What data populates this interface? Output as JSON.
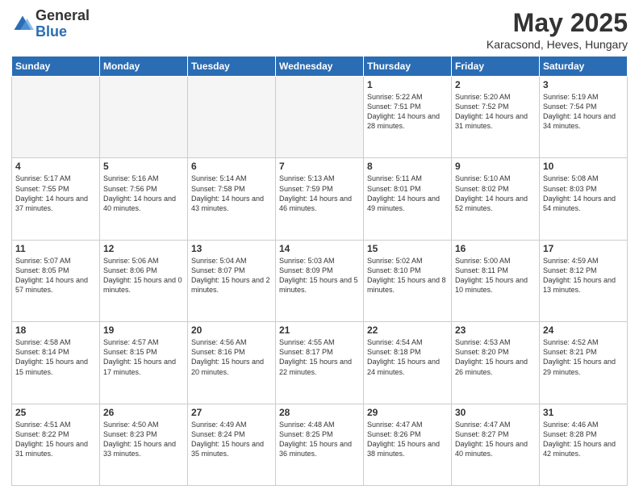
{
  "logo": {
    "general": "General",
    "blue": "Blue"
  },
  "header": {
    "month": "May 2025",
    "location": "Karacsond, Heves, Hungary"
  },
  "weekdays": [
    "Sunday",
    "Monday",
    "Tuesday",
    "Wednesday",
    "Thursday",
    "Friday",
    "Saturday"
  ],
  "weeks": [
    [
      {
        "day": "",
        "info": ""
      },
      {
        "day": "",
        "info": ""
      },
      {
        "day": "",
        "info": ""
      },
      {
        "day": "",
        "info": ""
      },
      {
        "day": "1",
        "info": "Sunrise: 5:22 AM\nSunset: 7:51 PM\nDaylight: 14 hours\nand 28 minutes."
      },
      {
        "day": "2",
        "info": "Sunrise: 5:20 AM\nSunset: 7:52 PM\nDaylight: 14 hours\nand 31 minutes."
      },
      {
        "day": "3",
        "info": "Sunrise: 5:19 AM\nSunset: 7:54 PM\nDaylight: 14 hours\nand 34 minutes."
      }
    ],
    [
      {
        "day": "4",
        "info": "Sunrise: 5:17 AM\nSunset: 7:55 PM\nDaylight: 14 hours\nand 37 minutes."
      },
      {
        "day": "5",
        "info": "Sunrise: 5:16 AM\nSunset: 7:56 PM\nDaylight: 14 hours\nand 40 minutes."
      },
      {
        "day": "6",
        "info": "Sunrise: 5:14 AM\nSunset: 7:58 PM\nDaylight: 14 hours\nand 43 minutes."
      },
      {
        "day": "7",
        "info": "Sunrise: 5:13 AM\nSunset: 7:59 PM\nDaylight: 14 hours\nand 46 minutes."
      },
      {
        "day": "8",
        "info": "Sunrise: 5:11 AM\nSunset: 8:01 PM\nDaylight: 14 hours\nand 49 minutes."
      },
      {
        "day": "9",
        "info": "Sunrise: 5:10 AM\nSunset: 8:02 PM\nDaylight: 14 hours\nand 52 minutes."
      },
      {
        "day": "10",
        "info": "Sunrise: 5:08 AM\nSunset: 8:03 PM\nDaylight: 14 hours\nand 54 minutes."
      }
    ],
    [
      {
        "day": "11",
        "info": "Sunrise: 5:07 AM\nSunset: 8:05 PM\nDaylight: 14 hours\nand 57 minutes."
      },
      {
        "day": "12",
        "info": "Sunrise: 5:06 AM\nSunset: 8:06 PM\nDaylight: 15 hours\nand 0 minutes."
      },
      {
        "day": "13",
        "info": "Sunrise: 5:04 AM\nSunset: 8:07 PM\nDaylight: 15 hours\nand 2 minutes."
      },
      {
        "day": "14",
        "info": "Sunrise: 5:03 AM\nSunset: 8:09 PM\nDaylight: 15 hours\nand 5 minutes."
      },
      {
        "day": "15",
        "info": "Sunrise: 5:02 AM\nSunset: 8:10 PM\nDaylight: 15 hours\nand 8 minutes."
      },
      {
        "day": "16",
        "info": "Sunrise: 5:00 AM\nSunset: 8:11 PM\nDaylight: 15 hours\nand 10 minutes."
      },
      {
        "day": "17",
        "info": "Sunrise: 4:59 AM\nSunset: 8:12 PM\nDaylight: 15 hours\nand 13 minutes."
      }
    ],
    [
      {
        "day": "18",
        "info": "Sunrise: 4:58 AM\nSunset: 8:14 PM\nDaylight: 15 hours\nand 15 minutes."
      },
      {
        "day": "19",
        "info": "Sunrise: 4:57 AM\nSunset: 8:15 PM\nDaylight: 15 hours\nand 17 minutes."
      },
      {
        "day": "20",
        "info": "Sunrise: 4:56 AM\nSunset: 8:16 PM\nDaylight: 15 hours\nand 20 minutes."
      },
      {
        "day": "21",
        "info": "Sunrise: 4:55 AM\nSunset: 8:17 PM\nDaylight: 15 hours\nand 22 minutes."
      },
      {
        "day": "22",
        "info": "Sunrise: 4:54 AM\nSunset: 8:18 PM\nDaylight: 15 hours\nand 24 minutes."
      },
      {
        "day": "23",
        "info": "Sunrise: 4:53 AM\nSunset: 8:20 PM\nDaylight: 15 hours\nand 26 minutes."
      },
      {
        "day": "24",
        "info": "Sunrise: 4:52 AM\nSunset: 8:21 PM\nDaylight: 15 hours\nand 29 minutes."
      }
    ],
    [
      {
        "day": "25",
        "info": "Sunrise: 4:51 AM\nSunset: 8:22 PM\nDaylight: 15 hours\nand 31 minutes."
      },
      {
        "day": "26",
        "info": "Sunrise: 4:50 AM\nSunset: 8:23 PM\nDaylight: 15 hours\nand 33 minutes."
      },
      {
        "day": "27",
        "info": "Sunrise: 4:49 AM\nSunset: 8:24 PM\nDaylight: 15 hours\nand 35 minutes."
      },
      {
        "day": "28",
        "info": "Sunrise: 4:48 AM\nSunset: 8:25 PM\nDaylight: 15 hours\nand 36 minutes."
      },
      {
        "day": "29",
        "info": "Sunrise: 4:47 AM\nSunset: 8:26 PM\nDaylight: 15 hours\nand 38 minutes."
      },
      {
        "day": "30",
        "info": "Sunrise: 4:47 AM\nSunset: 8:27 PM\nDaylight: 15 hours\nand 40 minutes."
      },
      {
        "day": "31",
        "info": "Sunrise: 4:46 AM\nSunset: 8:28 PM\nDaylight: 15 hours\nand 42 minutes."
      }
    ]
  ]
}
